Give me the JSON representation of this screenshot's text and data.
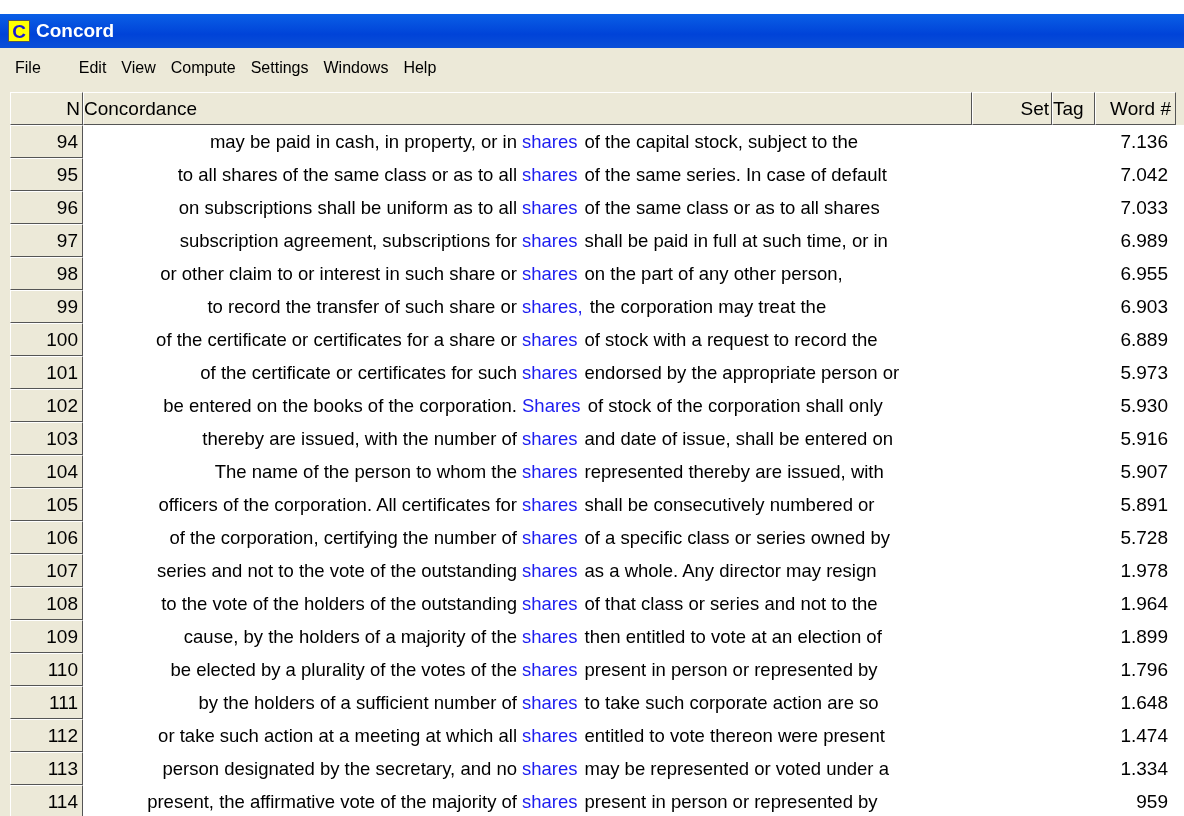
{
  "window": {
    "title": "Concord",
    "icon_letter": "C"
  },
  "menu": [
    "File",
    "Edit",
    "View",
    "Compute",
    "Settings",
    "Windows",
    "Help"
  ],
  "table": {
    "columns": [
      "N",
      "Concordance",
      "Set",
      "Tag",
      "Word #"
    ],
    "rows": [
      {
        "n": "94",
        "left": "may be paid in cash, in property, or in",
        "key": "shares",
        "right": "of the capital stock, subject to the",
        "word": "7.136"
      },
      {
        "n": "95",
        "left": "to all shares of the same class or as to all",
        "key": "shares",
        "right": "of the same series. In case of default",
        "word": "7.042"
      },
      {
        "n": "96",
        "left": "on subscriptions shall be uniform as to all",
        "key": "shares",
        "right": "of the same class or as to all shares",
        "word": "7.033"
      },
      {
        "n": "97",
        "left": "subscription agreement, subscriptions for",
        "key": "shares",
        "right": "shall be paid in full at such time, or in",
        "word": "6.989"
      },
      {
        "n": "98",
        "left": "or other claim to or interest in such share or",
        "key": "shares",
        "right": "on the part of any other person,",
        "word": "6.955"
      },
      {
        "n": "99",
        "left": "to record the transfer of such share or",
        "key": "shares,",
        "right": "the corporation may treat the",
        "word": "6.903"
      },
      {
        "n": "100",
        "left": "of the certificate or certificates for a share or",
        "key": "shares",
        "right": "of stock with a request to record the",
        "word": "6.889"
      },
      {
        "n": "101",
        "left": "of the certificate or certificates for such",
        "key": "shares",
        "right": "endorsed by the appropriate person or",
        "word": "5.973"
      },
      {
        "n": "102",
        "left": "be entered on the books of the corporation.",
        "key": "Shares",
        "right": "of stock of the corporation shall only",
        "word": "5.930"
      },
      {
        "n": "103",
        "left": "thereby are issued, with the number of",
        "key": "shares",
        "right": "and date of issue, shall be entered on",
        "word": "5.916"
      },
      {
        "n": "104",
        "left": "The name of the person to whom the",
        "key": "shares",
        "right": "represented thereby are issued, with",
        "word": "5.907"
      },
      {
        "n": "105",
        "left": "officers of the corporation. All certificates for",
        "key": "shares",
        "right": "shall be consecutively numbered or",
        "word": "5.891"
      },
      {
        "n": "106",
        "left": "of the corporation, certifying the number of",
        "key": "shares",
        "right": "of a specific class or series owned by",
        "word": "5.728"
      },
      {
        "n": "107",
        "left": "series and not to the vote of the outstanding",
        "key": "shares",
        "right": "as a whole. Any director may resign",
        "word": "1.978"
      },
      {
        "n": "108",
        "left": "to the vote of the holders of the outstanding",
        "key": "shares",
        "right": "of that class or series and not to the",
        "word": "1.964"
      },
      {
        "n": "109",
        "left": "cause, by the holders of a majority of the",
        "key": "shares",
        "right": "then entitled to vote at an election of",
        "word": "1.899"
      },
      {
        "n": "110",
        "left": "be elected by a plurality of the votes of the",
        "key": "shares",
        "right": "present in person or represented by",
        "word": "1.796"
      },
      {
        "n": "111",
        "left": "by the holders of a sufficient number of",
        "key": "shares",
        "right": "to take such corporate action are so",
        "word": "1.648"
      },
      {
        "n": "112",
        "left": "or take such action at a meeting at which all",
        "key": "shares",
        "right": "entitled to vote thereon were present",
        "word": "1.474"
      },
      {
        "n": "113",
        "left": "person designated by the secretary, and no",
        "key": "shares",
        "right": "may be represented or voted under a",
        "word": "1.334"
      },
      {
        "n": "114",
        "left": "present, the affirmative vote of the majority of",
        "key": "shares",
        "right": "present in person or represented by",
        "word": "959"
      }
    ]
  }
}
